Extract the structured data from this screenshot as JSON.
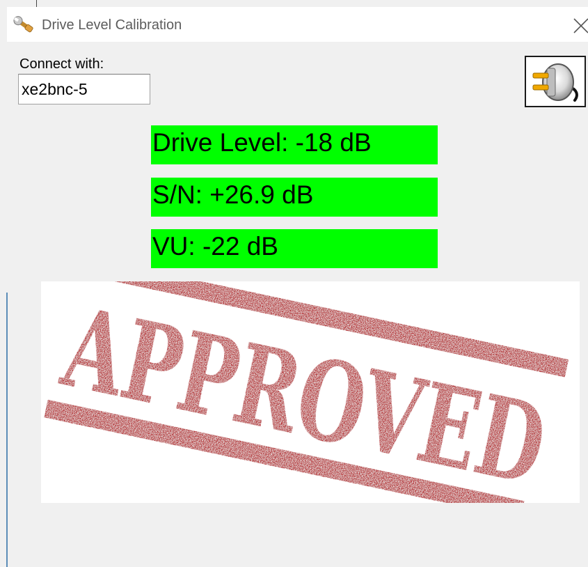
{
  "window": {
    "title": "Drive Level Calibration",
    "title_icon": "wrench-icon",
    "close_icon": "close-icon"
  },
  "connection": {
    "label": "Connect with:",
    "value": "xe2bnc-5",
    "button_icon": "plug-connect-icon"
  },
  "readouts": {
    "drive_level": "Drive Level: -18 dB",
    "snr": "S/N: +26.9 dB",
    "vu": "VU: -22 dB",
    "status_color": "#00ff00"
  },
  "status_stamp": {
    "text": "APPROVED",
    "color": "#b3121f"
  }
}
